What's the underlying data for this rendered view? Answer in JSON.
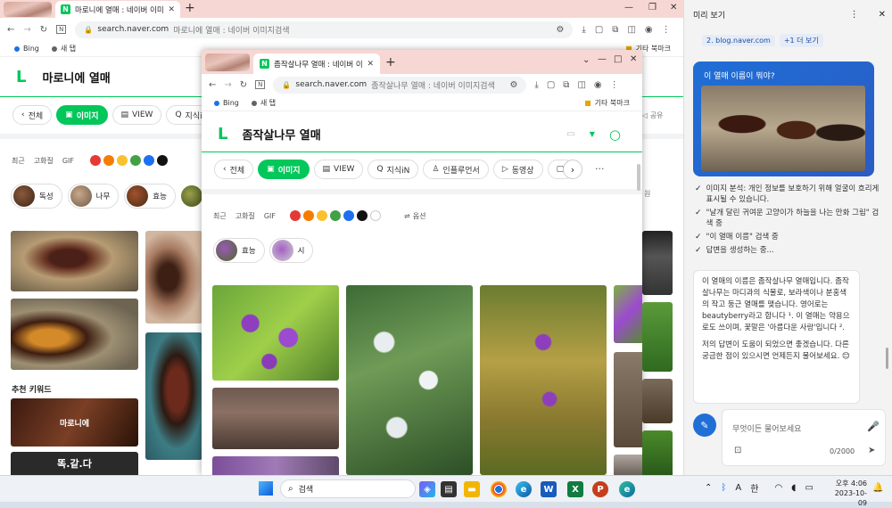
{
  "back_window": {
    "tab_title": "마로니에 열매 : 네이버 이미지검",
    "url_host": "search.naver.com",
    "url_rest": "마로니에 열매 : 네이버 이미지검색",
    "bookmarks": [
      "Bing",
      "새 탭"
    ],
    "bookmark_folder": "기타 북마크",
    "search_query": "마로니에 열매",
    "tabs": [
      "전체",
      "이미지",
      "VIEW",
      "지식iN"
    ],
    "filters": [
      "최근",
      "고화질",
      "GIF"
    ],
    "related": [
      "독성",
      "나무",
      "효능"
    ],
    "section_title": "추천 키워드",
    "keyword_card_1": "마로니에",
    "keyword_card_2": "똑.같.다"
  },
  "front_window": {
    "tab_title": "좀작살나무 열매 : 네이버 이미지",
    "url_host": "search.naver.com",
    "url_rest": "좀작살나무 열매 : 네이버 이미지검색",
    "bookmarks": [
      "Bing",
      "새 탭"
    ],
    "bookmark_folder": "기타 북마크",
    "search_query": "좀작살나무 열매",
    "tabs": [
      "전체",
      "이미지",
      "VIEW",
      "지식iN",
      "인플루언서",
      "동영상",
      "쇼"
    ],
    "filters": [
      "최근",
      "고화질",
      "GIF"
    ],
    "option_label": "옵션",
    "related": [
      "효능",
      "시"
    ]
  },
  "colors": {
    "swatches": [
      "#e53935",
      "#f57c00",
      "#fbc02d",
      "#43a047",
      "#1e6ff1",
      "#111111",
      "#ffffff"
    ],
    "naver_green": "#03c75a"
  },
  "copilot": {
    "header": "미리 보기",
    "source_link": "2. blog.naver.com",
    "more_link": "+1 더 보기",
    "user_message": "이 열매 이름이 뭐야?",
    "steps": [
      "이미지 분석: 개인 정보를 보호하기 위해 얼굴이 흐리게 표시될 수 있습니다.",
      "\"날개 달린 귀여운 고양이가 하늘을 나는 만화 그림\" 검색 중",
      "\"이 열매 이름\" 검색 중",
      "답변을 생성하는 중..."
    ],
    "answer_p1": "이 열매의 이름은 좀작살나무 열매입니다. 좀작살나무는 마디과의 식물로, 보라색이나 분홍색의 작고 둥근 열매를 맺습니다. 영어로는 beautyberry라고 합니다 ¹. 이 열매는 약용으로도 쓰이며, 꽃말은 '아름다운 사랑'입니다 ².",
    "answer_p2": "저의 답변이 도움이 되었으면 좋겠습니다. 다른 궁금한 점이 있으시면 언제든지 물어보세요. 😊",
    "input_placeholder": "무엇이든 물어보세요",
    "char_count": "0/2000"
  },
  "taskbar": {
    "search_label": "검색",
    "ime": "한",
    "time": "오후 4:06",
    "date": "2023-10-09"
  }
}
